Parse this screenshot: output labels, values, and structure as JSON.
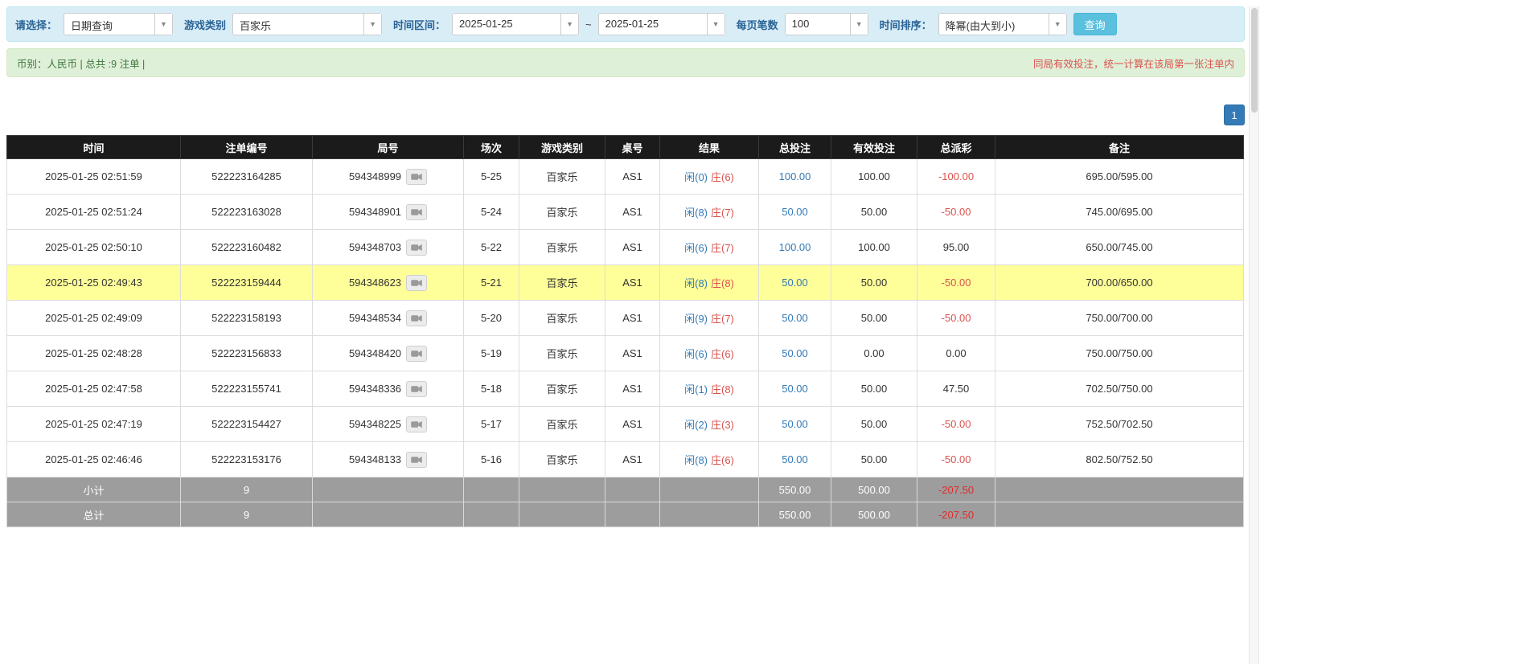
{
  "filters": {
    "select_label": "请选择：",
    "query_type": "日期查询",
    "game_type_label": "游戏类别",
    "game_type": "百家乐",
    "date_range_label": "时间区间：",
    "date_from": "2025-01-25",
    "date_separator": "~",
    "date_to": "2025-01-25",
    "page_size_label": "每页笔数",
    "page_size": "100",
    "sort_label": "时间排序：",
    "sort_value": "降幂(由大到小)",
    "search_button": "查询",
    "caret": "▼"
  },
  "info_bar": {
    "left": "币别：人民币 | 总共 :9 注单 |",
    "right": "同局有效投注，统一计算在该局第一张注单内"
  },
  "pagination": {
    "page": "1"
  },
  "table": {
    "headers": [
      "时间",
      "注单编号",
      "局号",
      "场次",
      "游戏类别",
      "桌号",
      "结果",
      "总投注",
      "有效投注",
      "总派彩",
      "备注"
    ],
    "rows": [
      {
        "time": "2025-01-25 02:51:59",
        "bet_id": "522223164285",
        "round_id": "594348999",
        "session": "5-25",
        "game": "百家乐",
        "table_no": "AS1",
        "player": "闲(0)",
        "banker": "庄(6)",
        "total_bet": "100.00",
        "valid_bet": "100.00",
        "payout": "-100.00",
        "remark": "695.00/595.00",
        "highlight": false
      },
      {
        "time": "2025-01-25 02:51:24",
        "bet_id": "522223163028",
        "round_id": "594348901",
        "session": "5-24",
        "game": "百家乐",
        "table_no": "AS1",
        "player": "闲(8)",
        "banker": "庄(7)",
        "total_bet": "50.00",
        "valid_bet": "50.00",
        "payout": "-50.00",
        "remark": "745.00/695.00",
        "highlight": false
      },
      {
        "time": "2025-01-25 02:50:10",
        "bet_id": "522223160482",
        "round_id": "594348703",
        "session": "5-22",
        "game": "百家乐",
        "table_no": "AS1",
        "player": "闲(6)",
        "banker": "庄(7)",
        "total_bet": "100.00",
        "valid_bet": "100.00",
        "payout": "95.00",
        "remark": "650.00/745.00",
        "highlight": false
      },
      {
        "time": "2025-01-25 02:49:43",
        "bet_id": "522223159444",
        "round_id": "594348623",
        "session": "5-21",
        "game": "百家乐",
        "table_no": "AS1",
        "player": "闲(8)",
        "banker": "庄(8)",
        "total_bet": "50.00",
        "valid_bet": "50.00",
        "payout": "-50.00",
        "remark": "700.00/650.00",
        "highlight": true
      },
      {
        "time": "2025-01-25 02:49:09",
        "bet_id": "522223158193",
        "round_id": "594348534",
        "session": "5-20",
        "game": "百家乐",
        "table_no": "AS1",
        "player": "闲(9)",
        "banker": "庄(7)",
        "total_bet": "50.00",
        "valid_bet": "50.00",
        "payout": "-50.00",
        "remark": "750.00/700.00",
        "highlight": false
      },
      {
        "time": "2025-01-25 02:48:28",
        "bet_id": "522223156833",
        "round_id": "594348420",
        "session": "5-19",
        "game": "百家乐",
        "table_no": "AS1",
        "player": "闲(6)",
        "banker": "庄(6)",
        "total_bet": "50.00",
        "valid_bet": "0.00",
        "payout": "0.00",
        "remark": "750.00/750.00",
        "highlight": false
      },
      {
        "time": "2025-01-25 02:47:58",
        "bet_id": "522223155741",
        "round_id": "594348336",
        "session": "5-18",
        "game": "百家乐",
        "table_no": "AS1",
        "player": "闲(1)",
        "banker": "庄(8)",
        "total_bet": "50.00",
        "valid_bet": "50.00",
        "payout": "47.50",
        "remark": "702.50/750.00",
        "highlight": false
      },
      {
        "time": "2025-01-25 02:47:19",
        "bet_id": "522223154427",
        "round_id": "594348225",
        "session": "5-17",
        "game": "百家乐",
        "table_no": "AS1",
        "player": "闲(2)",
        "banker": "庄(3)",
        "total_bet": "50.00",
        "valid_bet": "50.00",
        "payout": "-50.00",
        "remark": "752.50/702.50",
        "highlight": false
      },
      {
        "time": "2025-01-25 02:46:46",
        "bet_id": "522223153176",
        "round_id": "594348133",
        "session": "5-16",
        "game": "百家乐",
        "table_no": "AS1",
        "player": "闲(8)",
        "banker": "庄(6)",
        "total_bet": "50.00",
        "valid_bet": "50.00",
        "payout": "-50.00",
        "remark": "802.50/752.50",
        "highlight": false
      }
    ],
    "subtotal": {
      "label": "小计",
      "count": "9",
      "total_bet": "550.00",
      "valid_bet": "500.00",
      "payout": "-207.50"
    },
    "total": {
      "label": "总计",
      "count": "9",
      "total_bet": "550.00",
      "valid_bet": "500.00",
      "payout": "-207.50"
    }
  }
}
